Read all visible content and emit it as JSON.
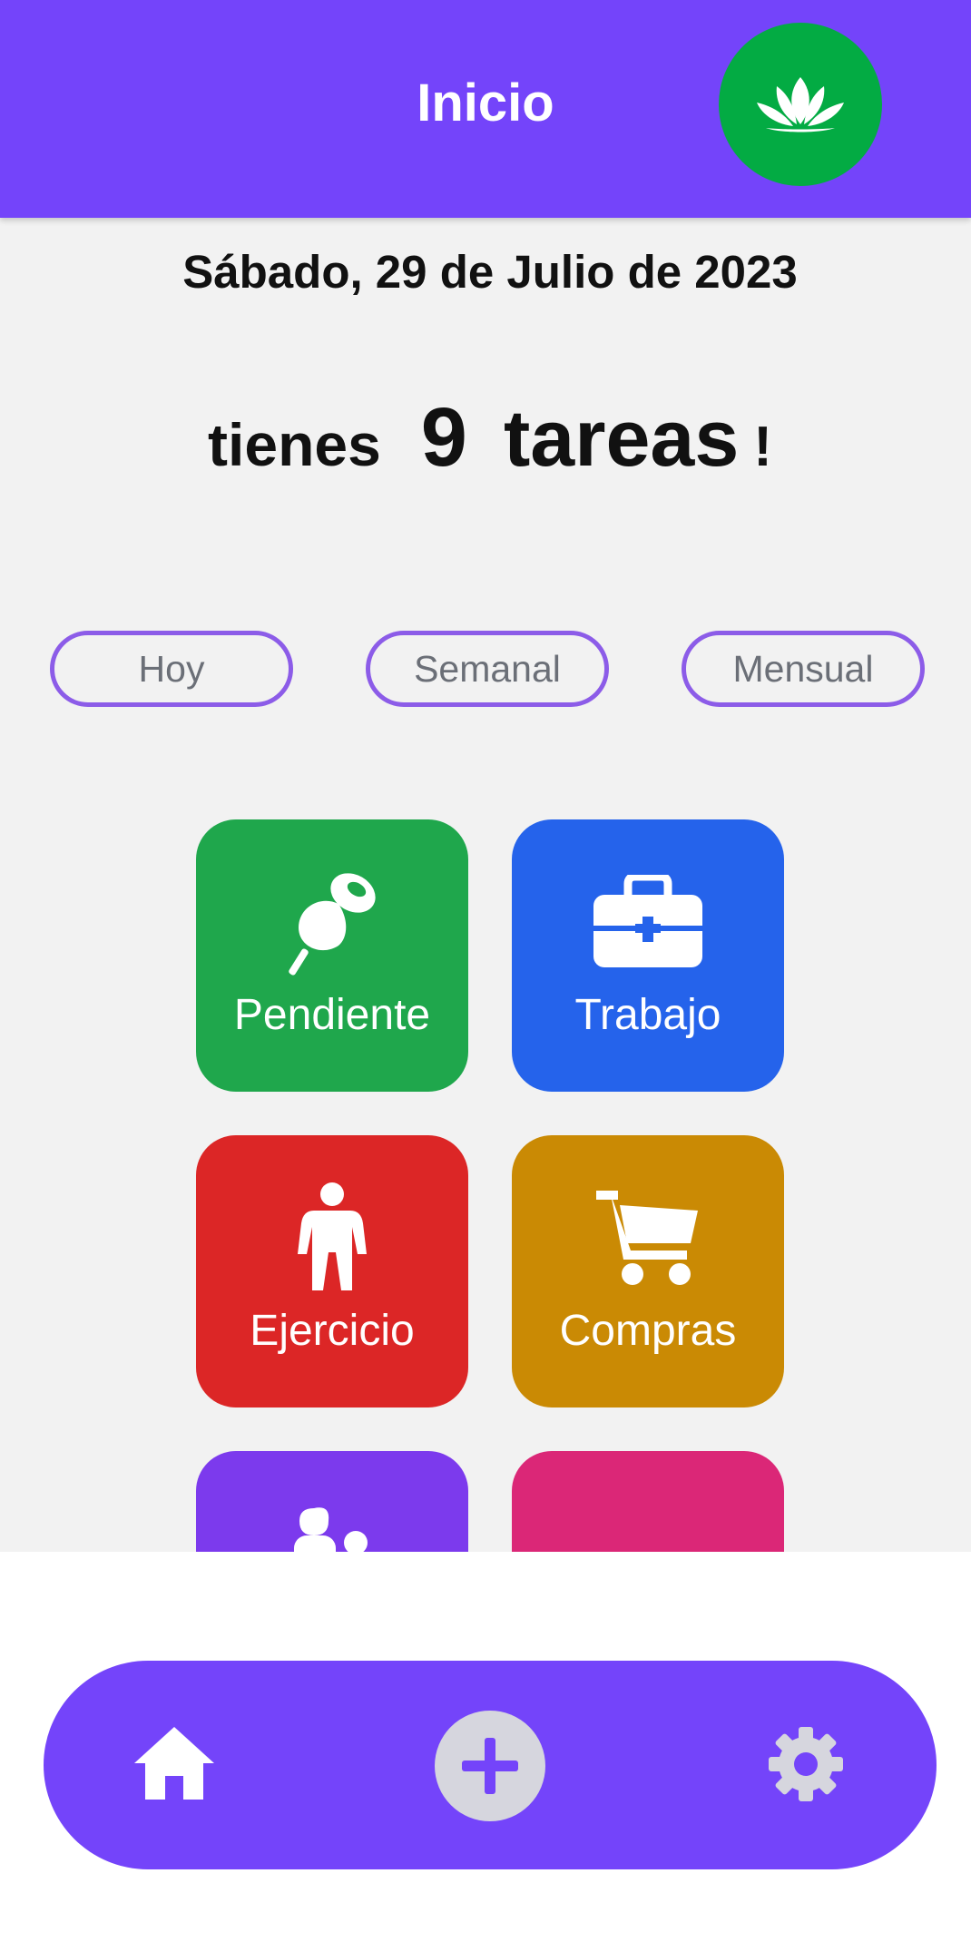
{
  "header": {
    "title": "Inicio",
    "avatar_icon": "lotus-icon"
  },
  "date_text": "Sábado, 29 de Julio de 2023",
  "summary": {
    "prefix": "tienes",
    "count": "9",
    "word": "tareas",
    "suffix": "!"
  },
  "filters": [
    {
      "label": "Hoy"
    },
    {
      "label": "Semanal"
    },
    {
      "label": "Mensual"
    }
  ],
  "categories": [
    {
      "label": "Pendiente",
      "icon": "pushpin-icon",
      "color": "#1fa74c"
    },
    {
      "label": "Trabajo",
      "icon": "toolbox-icon",
      "color": "#2563eb"
    },
    {
      "label": "Ejercicio",
      "icon": "person-icon",
      "color": "#dc2626"
    },
    {
      "label": "Compras",
      "icon": "cart-icon",
      "color": "#ca8a04"
    },
    {
      "label": "",
      "icon": "family-icon",
      "color": "#7c3aed"
    },
    {
      "label": "",
      "icon": "medical-icon",
      "color": "#db2777"
    }
  ],
  "nav": {
    "home_icon": "home-icon",
    "add_icon": "add-icon",
    "settings_icon": "gear-icon"
  },
  "colors": {
    "primary": "#7444fa",
    "avatar_bg": "#03ab43",
    "filter_border": "#8c5ce8"
  }
}
